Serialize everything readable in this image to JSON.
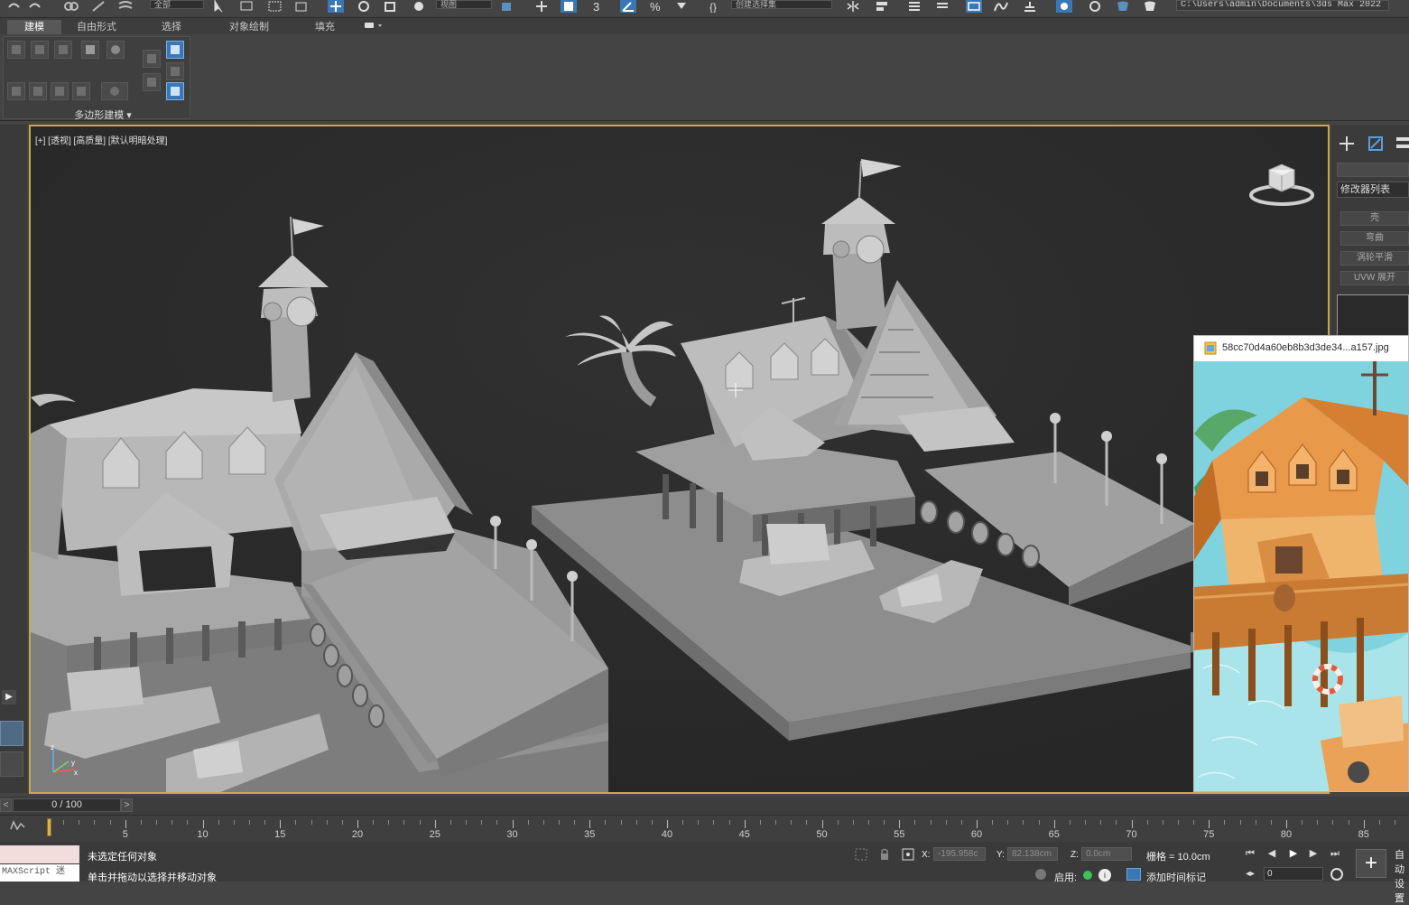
{
  "toolbar": {
    "selection_filter": "全部",
    "reference_coord": "视图",
    "named_selection": "创建选择集",
    "project_path": "C:\\Users\\admin\\Documents\\3ds Max 2022"
  },
  "ribbon": {
    "tabs": [
      "建模",
      "自由形式",
      "选择",
      "对象绘制",
      "填充"
    ],
    "active_tab": "建模",
    "group_label": "多边形建模 ▾"
  },
  "viewport": {
    "label": "[+] [透视] [高质量] [默认明暗处理]"
  },
  "command_panel": {
    "modifier_list_label": "修改器列表",
    "modifier_buttons": [
      "壳",
      "弯曲",
      "涡轮平滑",
      "UVW 展开"
    ]
  },
  "image_viewer": {
    "filename": "58cc70d4a60eb8b3d3de34...a157.jpg"
  },
  "time_slider": {
    "value": "0 / 100",
    "prev": "<",
    "next": ">"
  },
  "trackbar": {
    "labels": [
      "5",
      "10",
      "15",
      "20",
      "25",
      "30",
      "35",
      "40",
      "45",
      "50",
      "55",
      "60",
      "65",
      "70",
      "75",
      "80",
      "85"
    ]
  },
  "status": {
    "maxscript_label": "MAXScript 迷",
    "line1": "未选定任何对象",
    "line2": "单击并拖动以选择并移动对象",
    "x_label": "X:",
    "x_value": "-195.958c",
    "y_label": "Y:",
    "y_value": "82.138cm",
    "z_label": "Z:",
    "z_value": "0.0cm",
    "grid": "栅格 = 10.0cm",
    "enable": "启用:",
    "add_time_tag": "添加时间标记",
    "frame_value": "0",
    "right_stub": "自动 设置"
  },
  "colors": {
    "viewport_border": "#c8a94a",
    "active_button": "#3a78b5",
    "time_marker": "#d9b34c"
  }
}
